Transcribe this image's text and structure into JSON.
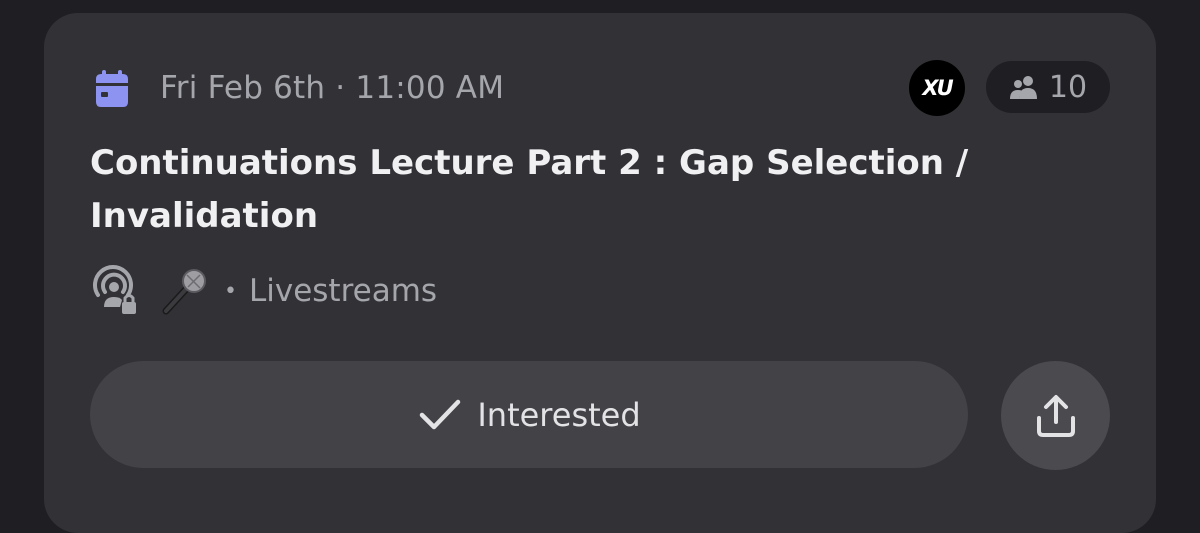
{
  "event": {
    "date_time": "Fri Feb 6th · 11:00 AM",
    "title": "Continuations Lecture Part 2 : Gap Selection / Invalidation",
    "bullet": "•",
    "channel": "Livestreams",
    "interested_count": "10",
    "host_avatar_text": "XU"
  },
  "actions": {
    "interested_label": "Interested"
  },
  "colors": {
    "background": "#1f1f23",
    "card": "#313136",
    "calendar_accent": "#8d93f0",
    "button": "#424247",
    "share_button": "#4a4a4f",
    "muted_text": "#a5a6ac"
  },
  "icons": {
    "calendar": "calendar-icon",
    "people": "people-icon",
    "stage": "stage-channel-locked-icon",
    "mic": "microphone-emoji-icon",
    "check": "check-icon",
    "share": "share-upload-icon"
  }
}
